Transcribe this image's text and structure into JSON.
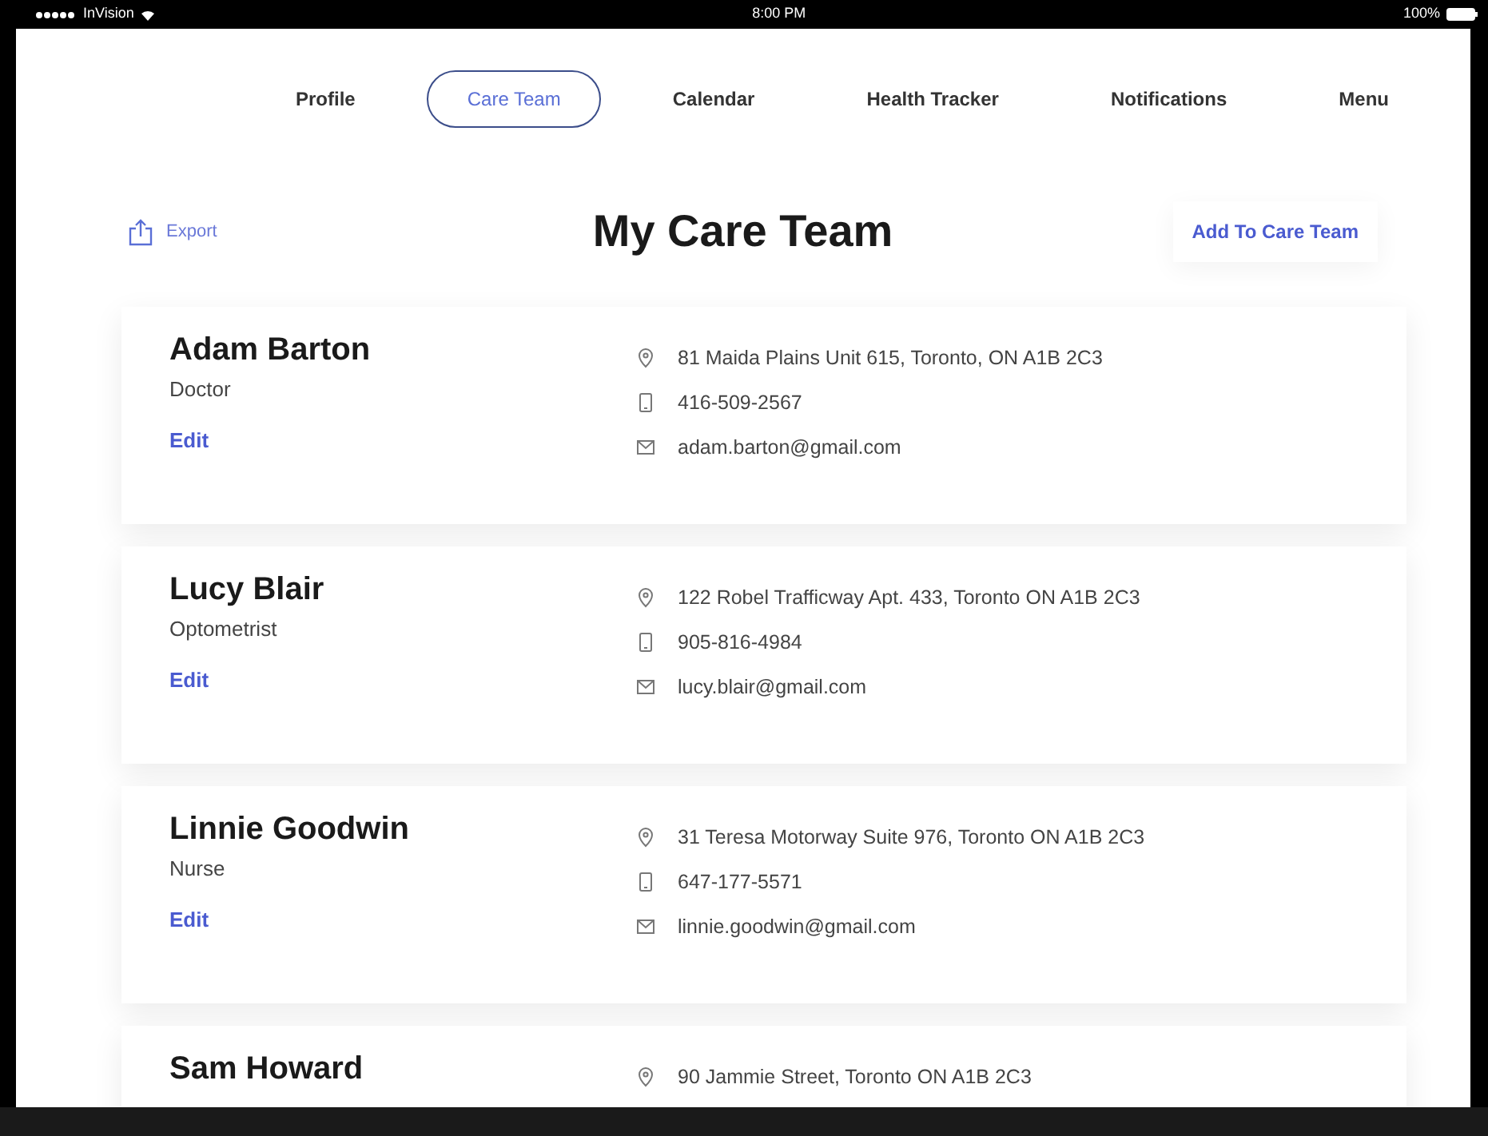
{
  "status_bar": {
    "carrier": "InVision",
    "time": "8:00 PM",
    "battery": "100%"
  },
  "tabs": [
    {
      "label": "Profile",
      "selected": false
    },
    {
      "label": "Care Team",
      "selected": true
    },
    {
      "label": "Calendar",
      "selected": false
    },
    {
      "label": "Health Tracker",
      "selected": false
    },
    {
      "label": "Notifications",
      "selected": false
    },
    {
      "label": "Menu",
      "selected": false
    }
  ],
  "header": {
    "export": "Export",
    "title": "My Care Team",
    "add": "Add To Care Team"
  },
  "members": [
    {
      "name": "Adam Barton",
      "role": "Doctor",
      "edit": "Edit",
      "address": "81 Maida Plains Unit 615, Toronto, ON A1B 2C3",
      "phone": "416-509-2567",
      "email": "adam.barton@gmail.com"
    },
    {
      "name": "Lucy Blair",
      "role": "Optometrist",
      "edit": "Edit",
      "address": "122 Robel Trafficway Apt. 433, Toronto ON A1B 2C3",
      "phone": "905-816-4984",
      "email": "lucy.blair@gmail.com"
    },
    {
      "name": "Linnie Goodwin",
      "role": "Nurse",
      "edit": "Edit",
      "address": "31 Teresa Motorway Suite 976, Toronto ON A1B 2C3",
      "phone": "647-177-5571",
      "email": "linnie.goodwin@gmail.com"
    },
    {
      "name": "Sam Howard",
      "address": "90 Jammie Street, Toronto ON A1B 2C3"
    }
  ]
}
